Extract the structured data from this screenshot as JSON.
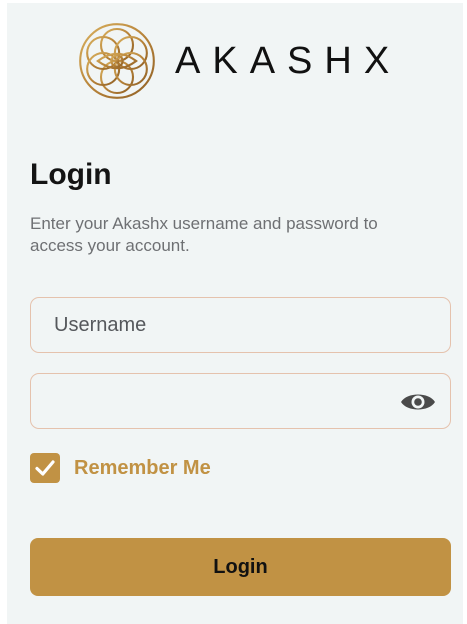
{
  "brand": {
    "name": "AKASHX",
    "logo_icon": "flower-of-life-eye-icon",
    "logo_color": "#c19244"
  },
  "login": {
    "title": "Login",
    "subtitle": "Enter your Akashx username and password to access your account.",
    "username_placeholder": "Username",
    "username_value": "",
    "password_value": "",
    "password_toggle_icon": "eye-icon",
    "remember_label": "Remember Me",
    "remember_checked": true,
    "button_label": "Login"
  },
  "colors": {
    "accent": "#c19244",
    "field_border": "#e5c2ad",
    "background": "#f1f5f5",
    "text_primary": "#141414",
    "text_secondary": "#6e7073"
  }
}
